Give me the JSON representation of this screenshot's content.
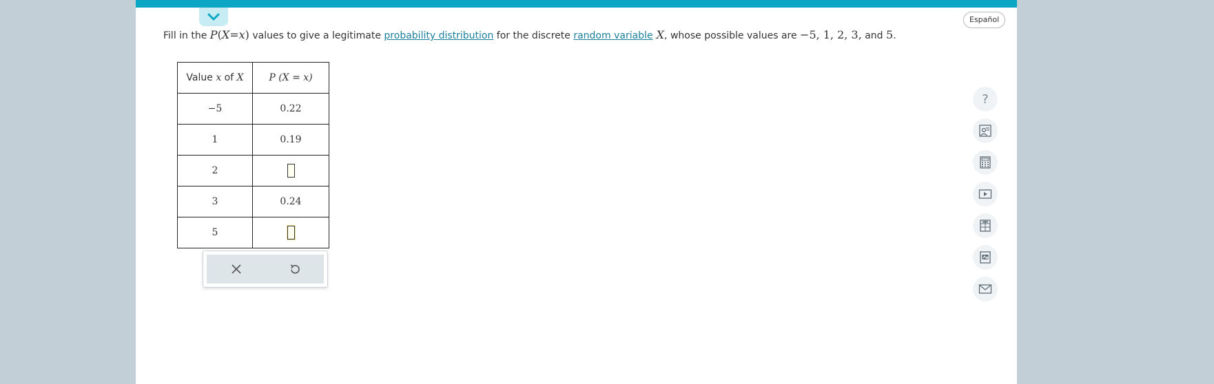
{
  "header": {
    "language_toggle": "Español"
  },
  "question": {
    "prefix": "Fill in the ",
    "pmath": {
      "p": "P",
      "lp": "(",
      "x1": "X",
      "eq": "=",
      "x2": "x",
      "rp": ")"
    },
    "mid1": " values to give a legitimate ",
    "link1": "probability distribution",
    "mid2": " for the discrete ",
    "link2": "random variable",
    "var": "X",
    "mid3": ", whose possible values are ",
    "values_text": "−5, 1, 2, 3,",
    "and_text": " and ",
    "last_value": "5",
    "end": "."
  },
  "table": {
    "header_col1": {
      "pre": "Value ",
      "x": "x",
      "mid": " of ",
      "X": "X"
    },
    "header_col2": "P (X = x)",
    "rows": [
      {
        "value": "−5",
        "prob": "0.22"
      },
      {
        "value": "1",
        "prob": "0.19"
      },
      {
        "value": "2",
        "prob": ""
      },
      {
        "value": "3",
        "prob": "0.24"
      },
      {
        "value": "5",
        "prob": ""
      }
    ]
  },
  "keypad": {
    "clear_icon": "close-icon",
    "undo_icon": "undo-icon"
  },
  "side_tools": [
    "help-icon",
    "tutor-icon",
    "calculator-icon",
    "video-icon",
    "table-icon",
    "textbook-icon",
    "email-icon"
  ],
  "side_tools_help_symbol": "?",
  "colors": {
    "accent": "#0aa6c4",
    "link": "#1a7f9a",
    "background": "#c2cfd6"
  }
}
